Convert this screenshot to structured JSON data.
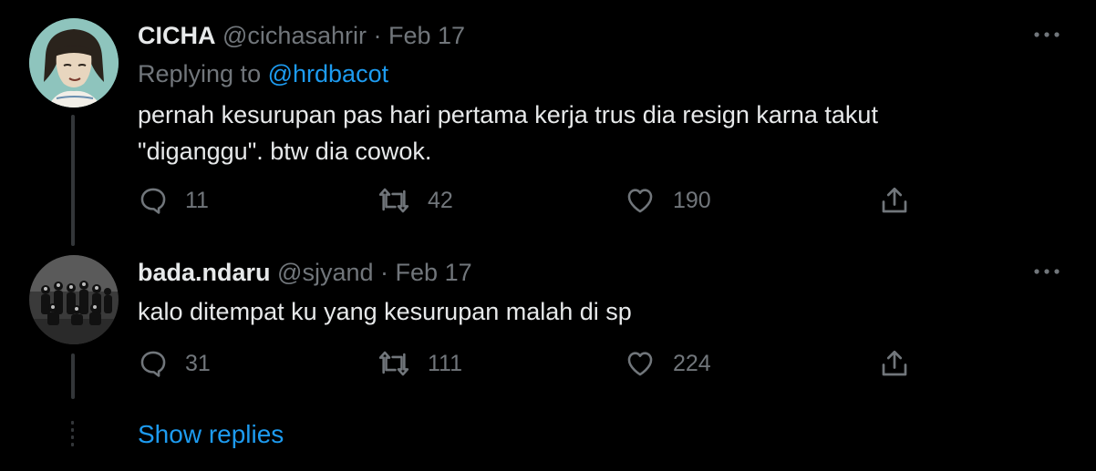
{
  "tweets": [
    {
      "name": "CICHA",
      "handle": "@cichasahrir",
      "separator": "·",
      "date": "Feb 17",
      "replying_prefix": "Replying to",
      "replying_to": "@hrdbacot",
      "text": "pernah kesurupan pas hari pertama kerja trus dia resign karna takut\n\"diganggu\". btw dia cowok.",
      "replies": "11",
      "retweets": "42",
      "likes": "190",
      "avatar": "illustrated-girl-avatar"
    },
    {
      "name": "bada.ndaru",
      "handle": "@sjyand",
      "separator": "·",
      "date": "Feb 17",
      "text": "kalo ditempat ku yang kesurupan malah di sp",
      "replies": "31",
      "retweets": "111",
      "likes": "224",
      "avatar": "group-photo-avatar"
    }
  ],
  "show_replies_label": "Show replies",
  "colors": {
    "background": "#000000",
    "text_primary": "#e7e9ea",
    "text_secondary": "#71767b",
    "accent": "#1d9bf0",
    "thread_line": "#333639"
  },
  "icons": [
    "reply-icon",
    "retweet-icon",
    "like-icon",
    "share-icon",
    "more-icon"
  ]
}
